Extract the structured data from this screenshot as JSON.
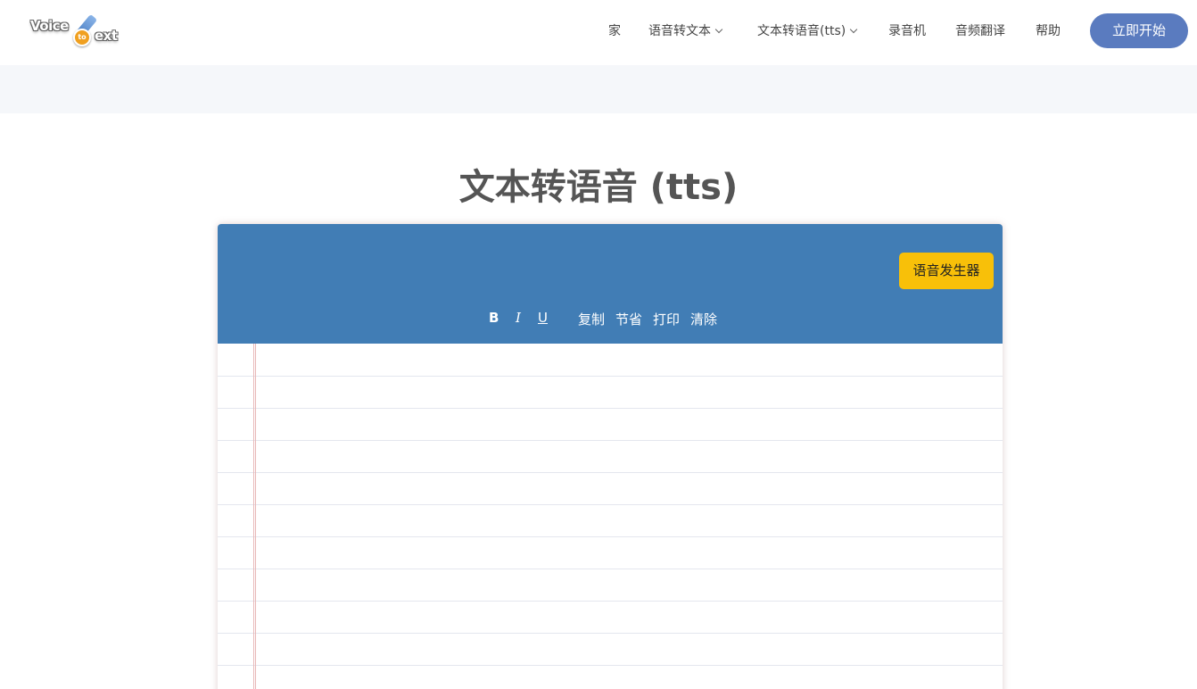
{
  "brand": {
    "logo_word_1": "Voice",
    "logo_badge": "to",
    "logo_word_2": "ext"
  },
  "nav": {
    "home": "家",
    "speech_to_text": "语音转文本",
    "text_to_speech": "文本转语音(tts)",
    "recorder": "录音机",
    "audio_translate": "音频翻译",
    "help": "帮助",
    "start": "立即开始"
  },
  "page": {
    "title": "文本转语音 (tts)"
  },
  "editor": {
    "voice_generator": "语音发生器",
    "toolbar": {
      "bold": "B",
      "italic": "I",
      "underline": "U",
      "copy": "复制",
      "save": "节省",
      "print": "打印",
      "clear": "清除"
    },
    "text": ""
  },
  "colors": {
    "toolbar_bg": "#417db5",
    "voice_button": "#f8c009",
    "start_button": "#5a7bbf",
    "band_bg": "#f5f7fa"
  }
}
